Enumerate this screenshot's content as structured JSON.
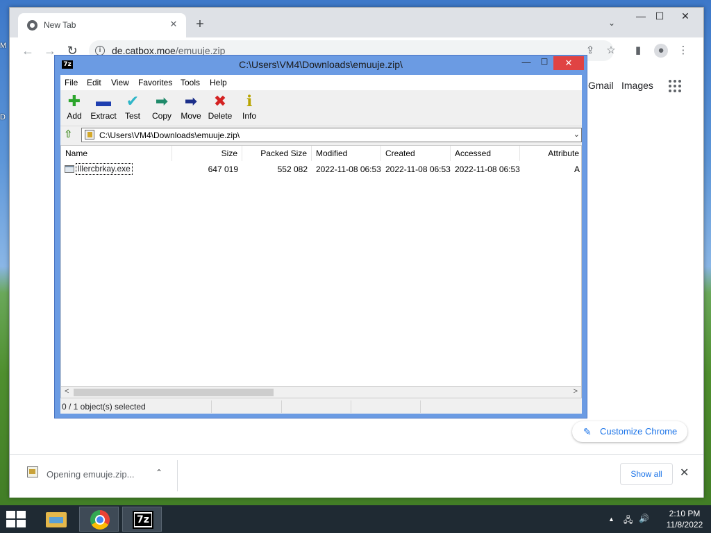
{
  "desktop": {
    "left_fragments": [
      "M",
      "D"
    ]
  },
  "chrome": {
    "tab_title": "New Tab",
    "tab_close": "✕",
    "new_tab": "+",
    "tab_search": "⌄",
    "win_min": "—",
    "win_max": "☐",
    "win_close": "✕",
    "url_domain": "de.catbox.moe",
    "url_path": "/emuuje.zip",
    "info_icon": "i",
    "ntp": {
      "gmail": "Gmail",
      "images": "Images",
      "customize": "Customize Chrome"
    },
    "download": {
      "filename": "Opening emuuje.zip...",
      "chevron": "⌃",
      "show_all": "Show all",
      "close": "✕"
    }
  },
  "sevenzip": {
    "logo": "7z",
    "title": "C:\\Users\\VM4\\Downloads\\emuuje.zip\\",
    "min": "—",
    "max": "☐",
    "close": "✕",
    "menu": [
      "File",
      "Edit",
      "View",
      "Favorites",
      "Tools",
      "Help"
    ],
    "toolbar": [
      {
        "label": "Add",
        "icon": "plus-icon",
        "glyph": "✚",
        "color": "#2ca52c"
      },
      {
        "label": "Extract",
        "icon": "minus-icon",
        "glyph": "▬",
        "color": "#1f3fb0"
      },
      {
        "label": "Test",
        "icon": "check-icon",
        "glyph": "✔",
        "color": "#2fb6c8"
      },
      {
        "label": "Copy",
        "icon": "copy-arrow-icon",
        "glyph": "➡",
        "color": "#1f8a6a"
      },
      {
        "label": "Move",
        "icon": "move-arrow-icon",
        "glyph": "➡",
        "color": "#1c2f8a"
      },
      {
        "label": "Delete",
        "icon": "delete-x-icon",
        "glyph": "✖",
        "color": "#d42222"
      },
      {
        "label": "Info",
        "icon": "info-icon",
        "glyph": "ℹ",
        "color": "#b8a400"
      }
    ],
    "address": "C:\\Users\\VM4\\Downloads\\emuuje.zip\\",
    "columns": [
      "Name",
      "Size",
      "Packed Size",
      "Modified",
      "Created",
      "Accessed",
      "Attribute"
    ],
    "files": [
      {
        "name": "lllercbrkay.exe",
        "size": "647 019",
        "packed": "552 082",
        "modified": "2022-11-08 06:53",
        "created": "2022-11-08 06:53",
        "accessed": "2022-11-08 06:53",
        "attributes": "A"
      }
    ],
    "status": "0 / 1 object(s) selected"
  },
  "taskbar": {
    "time": "2:10 PM",
    "date": "11/8/2022",
    "sevenzip_label": "7z",
    "tray_up": "▲",
    "network": "🖧",
    "volume": "🔊"
  }
}
